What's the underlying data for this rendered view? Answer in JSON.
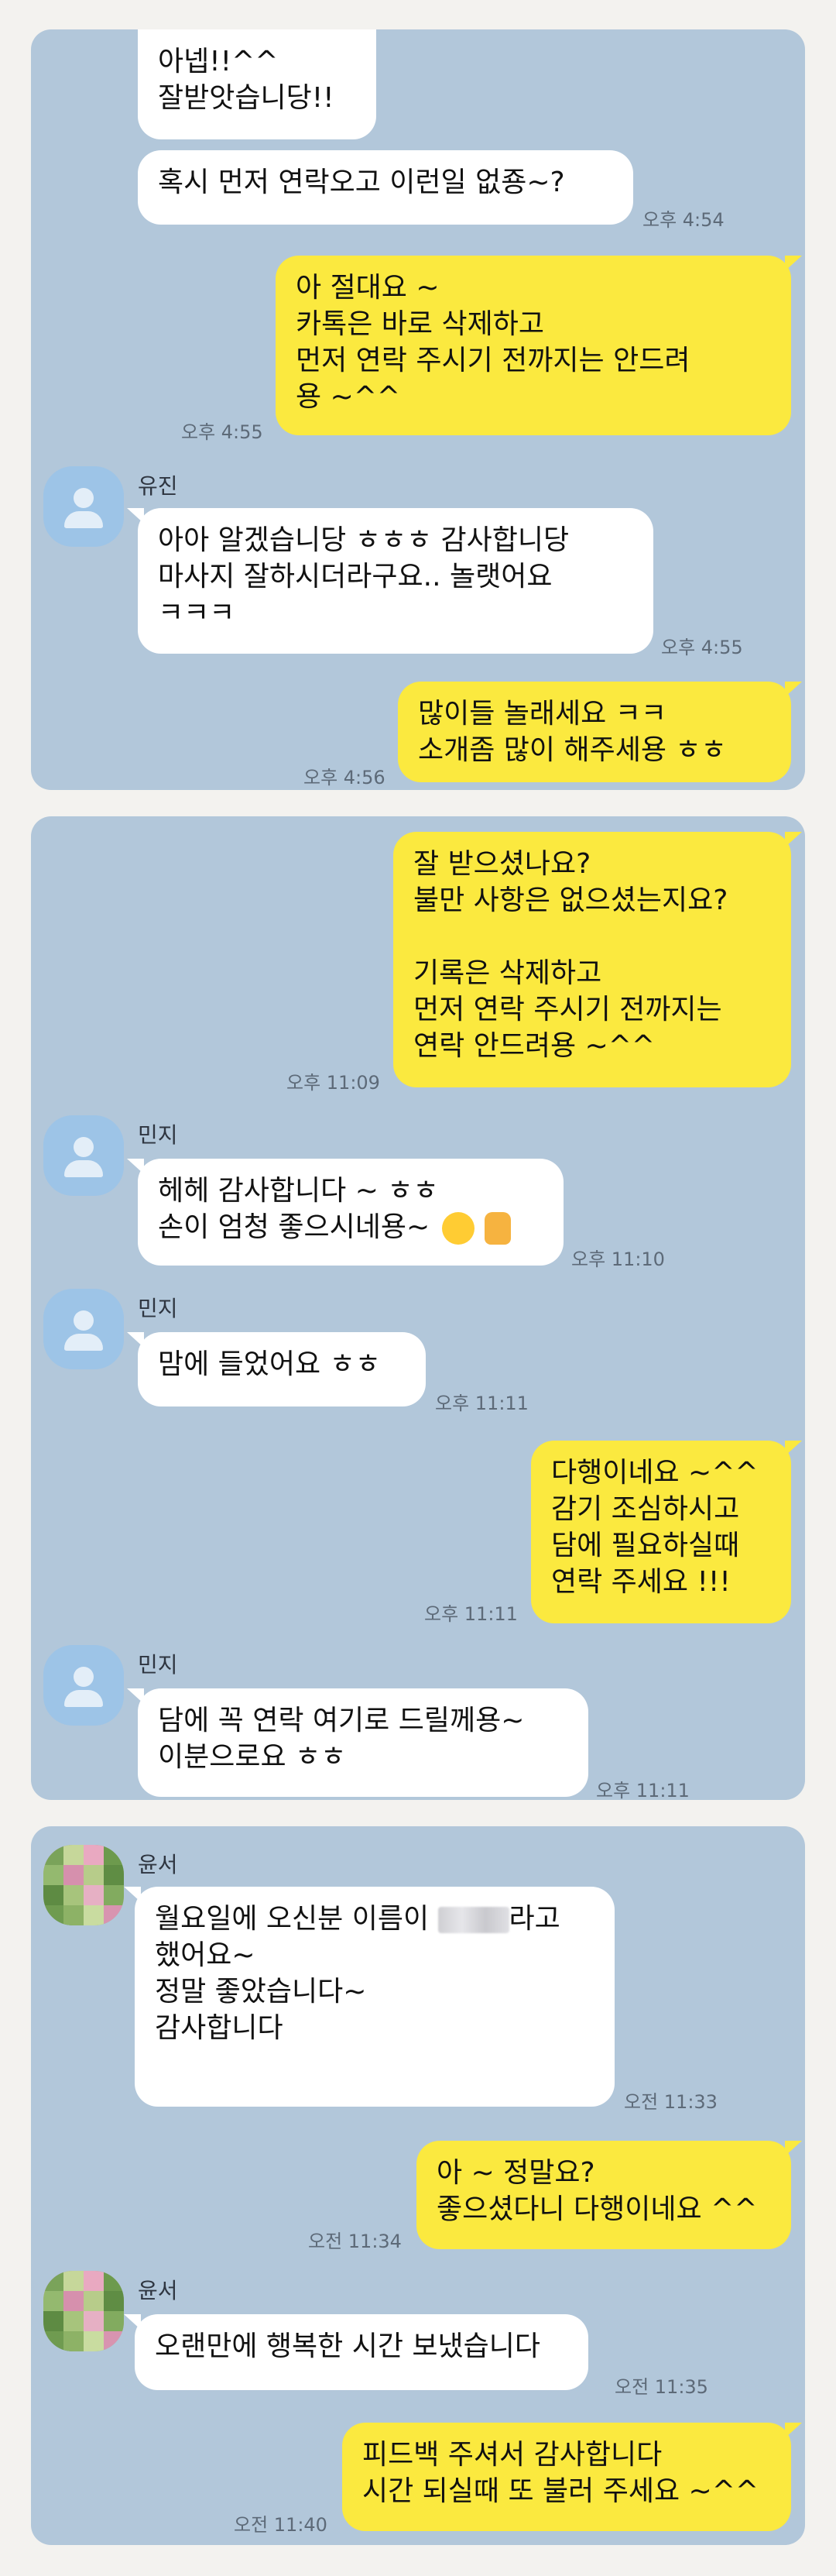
{
  "colors": {
    "page_bg": "#f3f2ef",
    "chat_bg": "#b2c7da",
    "sent_bubble": "#fbe93f",
    "received_bubble": "#ffffff"
  },
  "panel1": {
    "m1": "아넵!!^^\n잘받앗습니당!!",
    "m2": "혹시 먼저 연락오고 이런일 없죵~?",
    "m2_time": "오후 4:54",
    "m3": "아 절대요 ~\n카톡은 바로 삭제하고\n먼저 연락 주시기 전까지는 안드려\n용 ~^^",
    "m3_time": "오후 4:55",
    "sender": "유진",
    "m4": "아아 알겠습니당 ㅎㅎㅎ 감사합니당\n마사지 잘하시더라구요.. 놀랫어요\nㅋㅋㅋ",
    "m4_time": "오후 4:55",
    "m5": "많이들 놀래세요 ㅋㅋ\n소개좀 많이 해주세용 ㅎㅎ",
    "m5_time": "오후 4:56"
  },
  "panel2": {
    "m1": "잘 받으셨나요?\n불만 사항은 없으셨는지요?\n\n기록은 삭제하고\n먼저 연락 주시기 전까지는\n연락 안드려용 ~^^",
    "m1_time": "오후 11:09",
    "sender": "민지",
    "m2_line1": "헤헤 감사합니다 ~ ㅎㅎ",
    "m2_line2": "손이 엄청 좋으시네용~",
    "m2_time": "오후 11:10",
    "m3": "맘에 들었어요 ㅎㅎ",
    "m3_time": "오후 11:11",
    "m4": "다행이네요 ~^^\n감기 조심하시고\n담에 필요하실때\n연락 주세요 !!!",
    "m4_time": "오후 11:11",
    "m5": "담에 꼭 연락 여기로 드릴께용~\n이분으로요 ㅎㅎ",
    "m5_time": "오후 11:11"
  },
  "panel3": {
    "sender": "윤서",
    "m1_line1_a": "월요일에 오신분 이름이",
    "m1_line1_b": "라고",
    "m1_rest": "했어요~\n정말 좋았습니다~\n감사합니다",
    "m1_time": "오전 11:33",
    "m2": "아 ~ 정말요?\n좋으셨다니 다행이네요 ^^",
    "m2_time": "오전 11:34",
    "m3": "오랜만에 행복한 시간 보냈습니다",
    "m3_time": "오전 11:35",
    "m4": "피드백 주셔서 감사합니다\n시간 되실때 또 불러 주세요 ~^^",
    "m4_time": "오전 11:40"
  },
  "icons": {
    "default_avatar": "person-silhouette-icon",
    "emoji": "winking-tongue-emoji-icon",
    "thumbs_up": "thumbs-up-icon"
  }
}
